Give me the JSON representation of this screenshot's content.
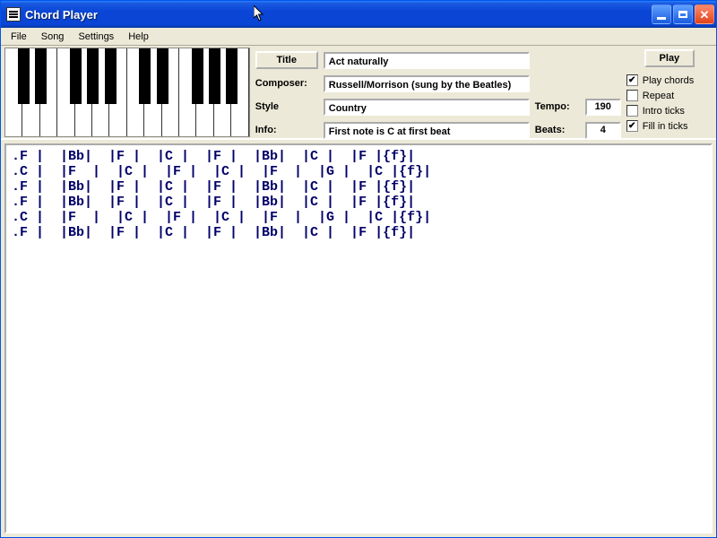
{
  "window": {
    "title": "Chord Player"
  },
  "menu": {
    "items": [
      "File",
      "Song",
      "Settings",
      "Help"
    ]
  },
  "piano": {
    "white_keys": 14,
    "black_positions_pct": [
      5.0,
      12.1,
      26.4,
      33.6,
      40.7,
      55.0,
      62.1,
      76.4,
      83.6,
      90.7
    ]
  },
  "form": {
    "title_btn": "Title",
    "title_val": "Act naturally",
    "composer_lbl": "Composer:",
    "composer_val": "Russell/Morrison (sung by the Beatles)",
    "style_lbl": "Style",
    "style_val": "Country",
    "info_lbl": "Info:",
    "info_val": "First note is C at first beat",
    "tempo_lbl": "Tempo:",
    "tempo_val": "190",
    "beats_lbl": "Beats:",
    "beats_val": "4"
  },
  "controls": {
    "play_btn": "Play",
    "checks": [
      {
        "label": "Play chords",
        "checked": true
      },
      {
        "label": "Repeat",
        "checked": false
      },
      {
        "label": "Intro ticks",
        "checked": false
      },
      {
        "label": "Fill in ticks",
        "checked": true
      }
    ]
  },
  "chords": {
    "lines": [
      ".F |  |Bb|  |F |  |C |  |F |  |Bb|  |C |  |F |{f}|",
      ".C |  |F  |  |C |  |F |  |C |  |F  |  |G |  |C |{f}|",
      ".F |  |Bb|  |F |  |C |  |F |  |Bb|  |C |  |F |{f}|",
      ".F |  |Bb|  |F |  |C |  |F |  |Bb|  |C |  |F |{f}|",
      ".C |  |F  |  |C |  |F |  |C |  |F  |  |G |  |C |{f}|",
      ".F |  |Bb|  |F |  |C |  |F |  |Bb|  |C |  |F |{f}|"
    ]
  }
}
